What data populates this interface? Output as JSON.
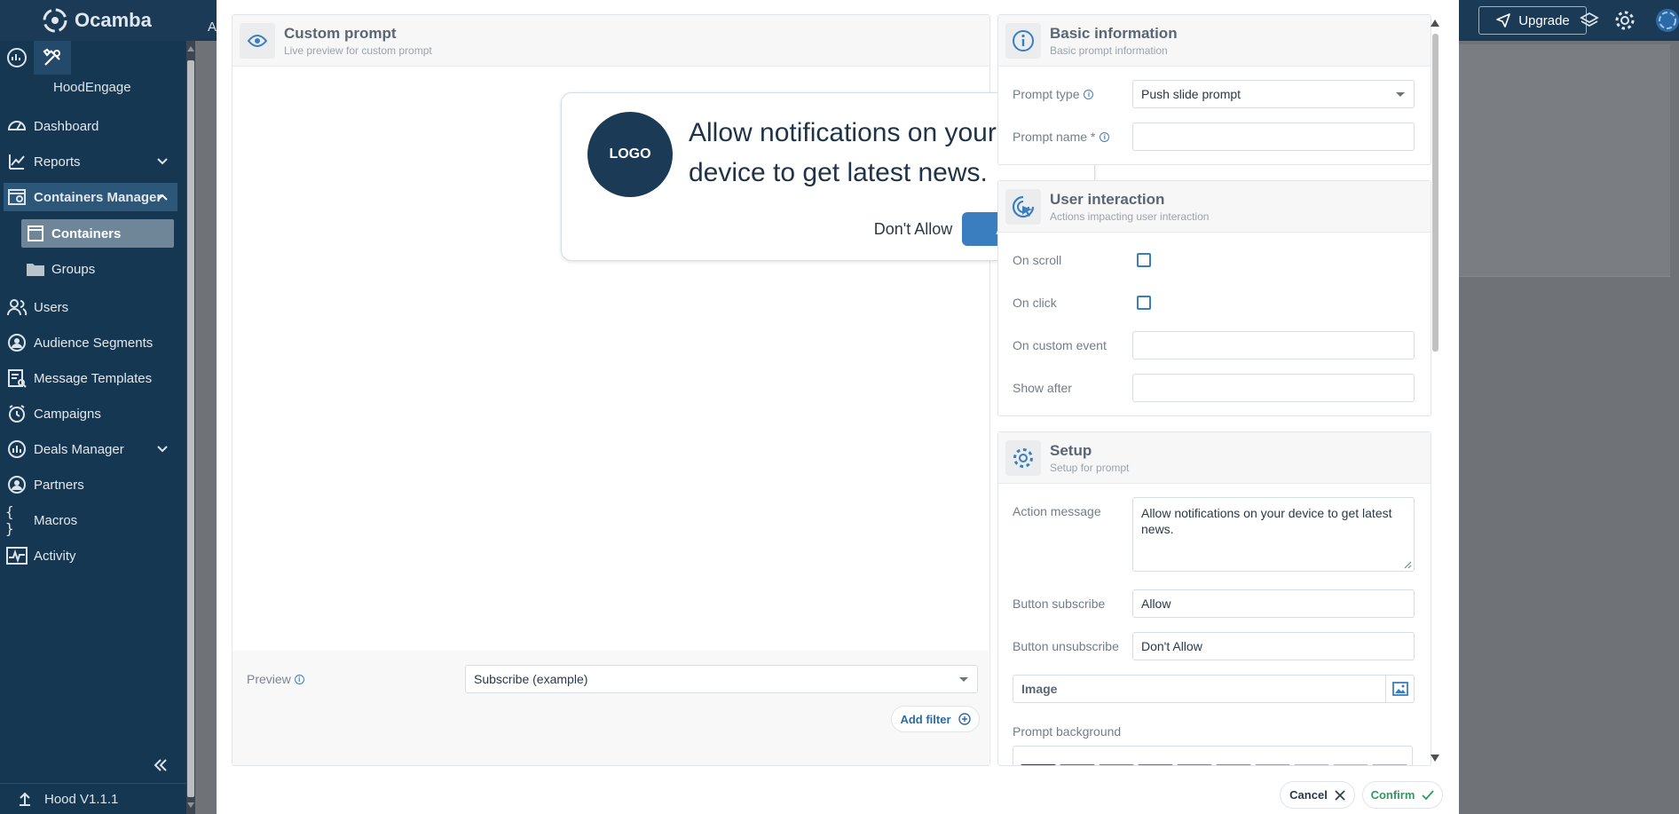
{
  "app": {
    "brand": "Ocamba",
    "upgrade_label": "Upgrade",
    "top_bar_partial": "A"
  },
  "sidebar": {
    "account": "HoodEngage",
    "items": [
      {
        "label": "Dashboard",
        "icon": "dashboard-icon"
      },
      {
        "label": "Reports",
        "icon": "reports-icon"
      },
      {
        "label": "Containers Manager",
        "icon": "containers-manager-icon"
      },
      {
        "label": "Users",
        "icon": "users-icon"
      },
      {
        "label": "Audience Segments",
        "icon": "audience-segments-icon"
      },
      {
        "label": "Message Templates",
        "icon": "message-templates-icon"
      },
      {
        "label": "Campaigns",
        "icon": "campaigns-icon"
      },
      {
        "label": "Deals Manager",
        "icon": "deals-manager-icon"
      },
      {
        "label": "Partners",
        "icon": "partners-icon"
      },
      {
        "label": "Macros",
        "icon": "macros-icon"
      },
      {
        "label": "Activity",
        "icon": "activity-icon"
      }
    ],
    "subitems": [
      {
        "label": "Containers",
        "icon": "container-icon"
      },
      {
        "label": "Groups",
        "icon": "folder-icon"
      }
    ],
    "version": "Hood V1.1.1"
  },
  "preview_panel": {
    "title": "Custom prompt",
    "subtitle": "Live preview for custom prompt",
    "prompt": {
      "logo": "LOGO",
      "message": "Allow notifications on your device to get latest news.",
      "dont_allow": "Don't Allow",
      "allow": "Allow"
    },
    "preview_label": "Preview",
    "preview_value": "Subscribe (example)",
    "add_filter": "Add filter"
  },
  "basic_info": {
    "title": "Basic information",
    "subtitle": "Basic prompt information",
    "prompt_type_label": "Prompt type",
    "prompt_type_value": "Push slide prompt",
    "prompt_name_label": "Prompt name *",
    "prompt_name_value": ""
  },
  "user_interaction": {
    "title": "User interaction",
    "subtitle": "Actions impacting user interaction",
    "on_scroll": "On scroll",
    "on_click": "On click",
    "on_custom_event": "On custom event",
    "show_after": "Show after"
  },
  "setup": {
    "title": "Setup",
    "subtitle": "Setup for prompt",
    "action_message_label": "Action message",
    "action_message_value": "Allow notifications on your device to get latest news.",
    "button_subscribe_label": "Button subscribe",
    "button_subscribe_value": "Allow",
    "button_unsubscribe_label": "Button unsubscribe",
    "button_unsubscribe_value": "Don't Allow",
    "image_label": "Image",
    "prompt_background_label": "Prompt background",
    "swatch_colors": [
      "#3a3a3a",
      "#d63a3a",
      "#e5533c",
      "#3b7ec0",
      "#8e6ccf",
      "#3aa2d6",
      "#7bbf45",
      "#f0b03a",
      "#f0a58a",
      "#b0b0b0"
    ]
  },
  "footer": {
    "cancel": "Cancel",
    "confirm": "Confirm"
  },
  "colors": {
    "brand": "#1b3a56",
    "accent": "#3b7ec0",
    "confirm": "#2e9a5e"
  }
}
